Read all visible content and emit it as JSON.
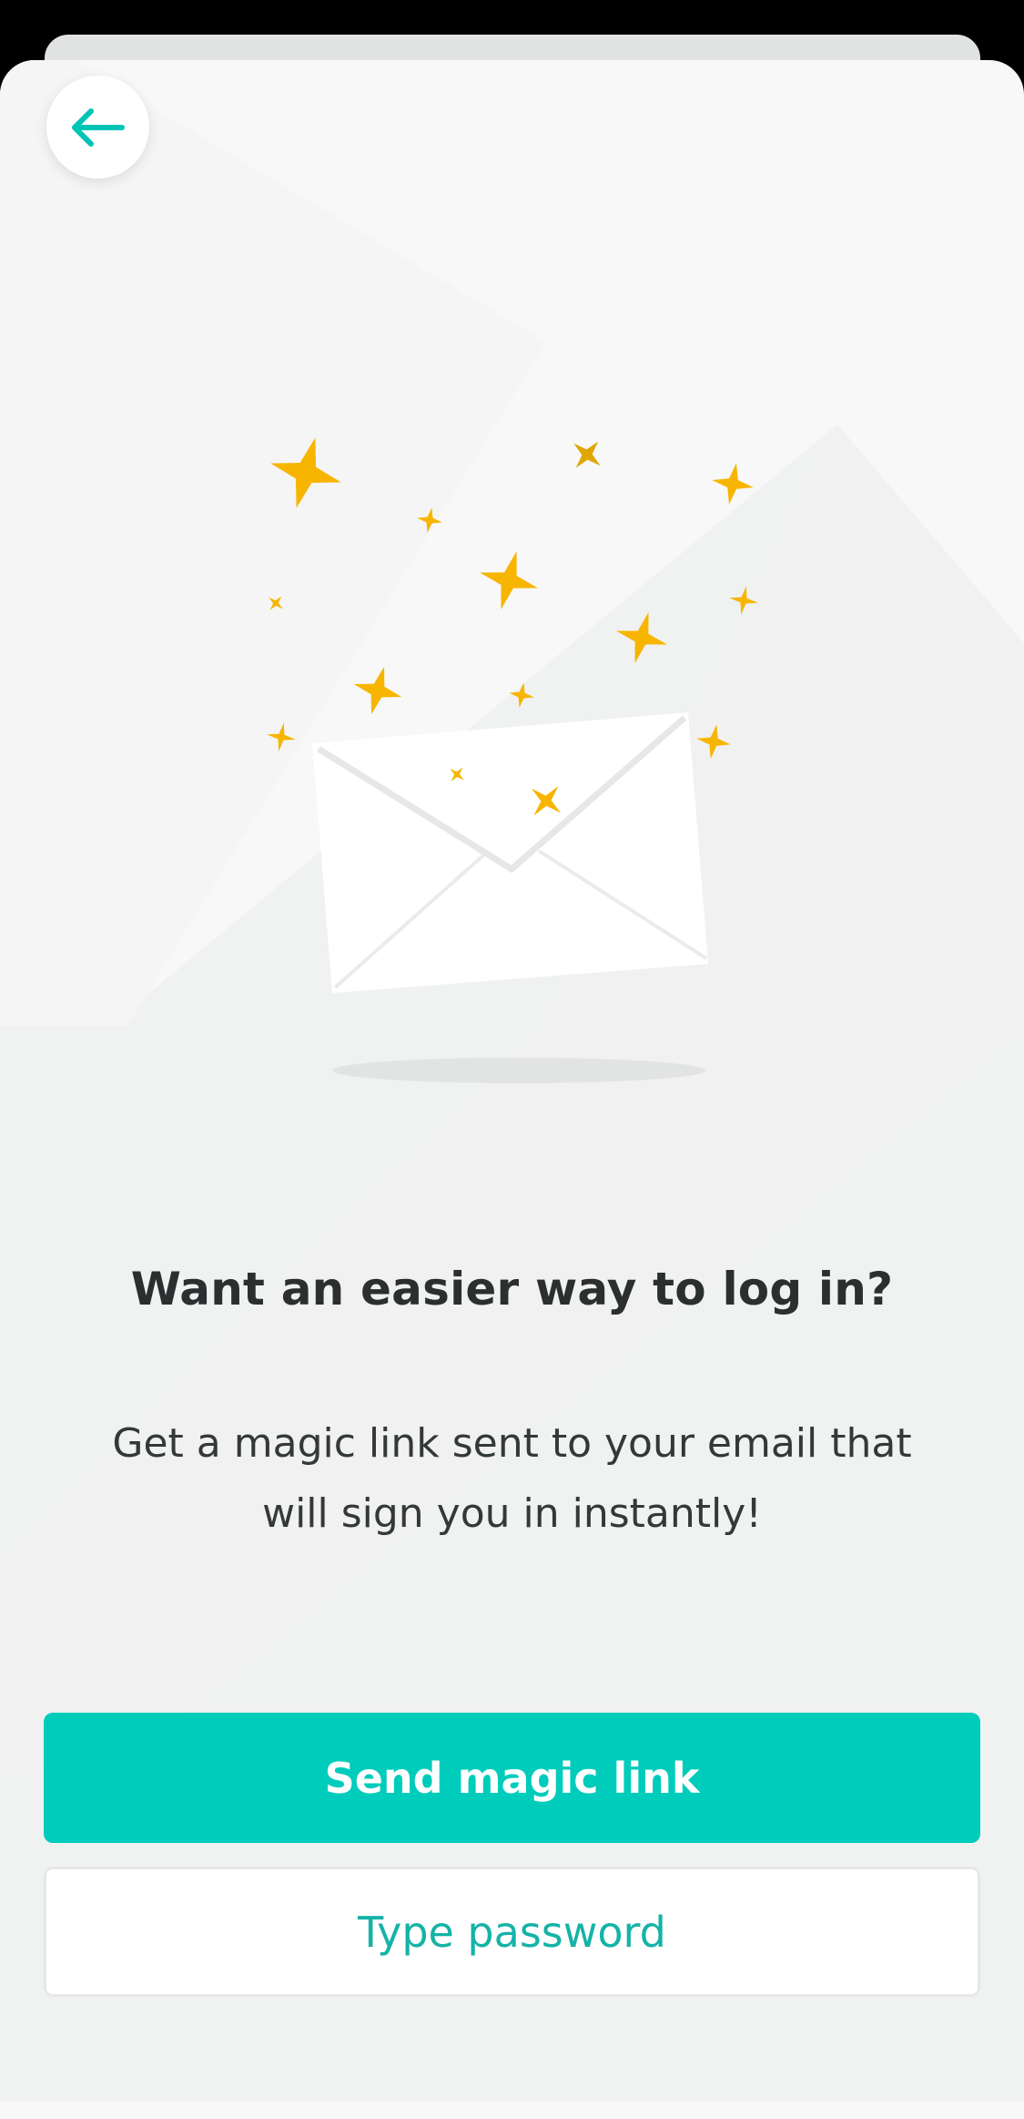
{
  "header": {
    "back_icon": "arrow-left-icon"
  },
  "colors": {
    "accent": "#00ccbb",
    "accent_text": "#15b3a7",
    "star": "#f7b500",
    "heading": "#2b2f30"
  },
  "illustration": {
    "icon": "envelope-icon",
    "decoration": "sparkle-stars"
  },
  "content": {
    "title": "Want an easier way to log in?",
    "description": "Get a magic link sent to your email that will sign you in instantly!"
  },
  "actions": {
    "primary_label": "Send magic link",
    "secondary_label": "Type password"
  }
}
